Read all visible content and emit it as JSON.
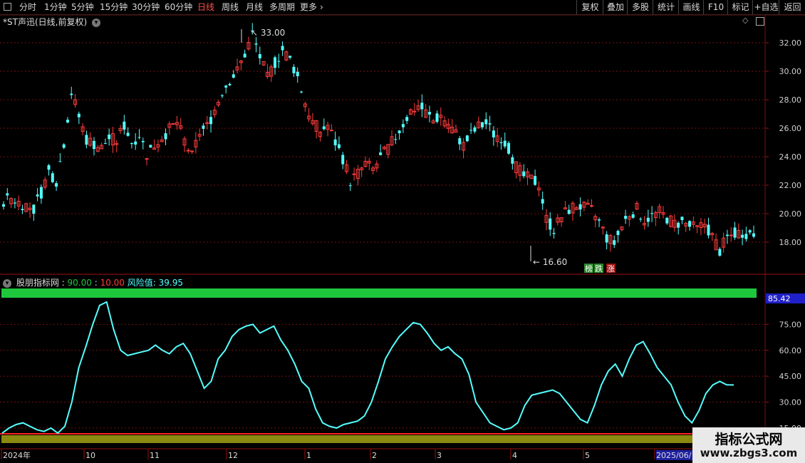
{
  "toolbar": {
    "periods": [
      "分时",
      "1分钟",
      "5分钟",
      "15分钟",
      "30分钟",
      "60分钟",
      "日线",
      "周线",
      "月线",
      "多周期",
      "更多"
    ],
    "active_period": "日线",
    "right_buttons": [
      "复权",
      "叠加",
      "多股",
      "统计",
      "画线",
      "F10",
      "标记",
      "+自选",
      "返回"
    ]
  },
  "colors": {
    "up": "#ff3c3c",
    "down": "#54ffff",
    "grid": "#7a1010",
    "ind_line": "#54ffff",
    "upper_band": "#1ec83c",
    "lower_band": "#8a8a10",
    "red_line": "#ff2020",
    "ind_value_bg": "#2020c8"
  },
  "main_chart": {
    "title": "*ST声迅(日线,前复权)",
    "price_ticks": [
      "32.00",
      "30.00",
      "28.00",
      "26.00",
      "24.00",
      "22.00",
      "20.00",
      "18.00"
    ],
    "high_label": "33.00",
    "low_label": "16.60",
    "badges": [
      "榜",
      "跌",
      "涨"
    ]
  },
  "indicator": {
    "name": "股朋指标网",
    "upper_value": "90.00",
    "lower_value": "10.00",
    "risk_label": "风险值: 39.95",
    "current_value": "85.42",
    "axis_ticks": [
      "75.00",
      "60.00",
      "45.00",
      "30.00",
      "15.00"
    ]
  },
  "x_axis": {
    "labels": [
      "2024年",
      "10",
      "11",
      "12",
      "1",
      "2",
      "3",
      "4",
      "5",
      "2025/06/"
    ]
  },
  "watermark": {
    "line1": "指标公式网",
    "line2": "www.zbgs3.com"
  },
  "chart_data": {
    "type": "candlestick",
    "price_range": [
      16.6,
      33.0
    ],
    "indicator_range": [
      10,
      90
    ],
    "close_trend": [
      20.9,
      21.1,
      20.8,
      20.6,
      20.3,
      21.5,
      23.0,
      22.3,
      25.0,
      28.5,
      26.8,
      25.2,
      24.9,
      24.6,
      25.3,
      25.1,
      26.2,
      25.0,
      25.6,
      24.2,
      24.8,
      25.4,
      25.9,
      26.4,
      25.1,
      24.0,
      25.7,
      26.1,
      27.3,
      28.6,
      29.4,
      30.0,
      31.2,
      32.6,
      31.0,
      29.5,
      30.6,
      31.5,
      30.8,
      29.6,
      27.8,
      26.4,
      25.8,
      26.2,
      25.0,
      23.9,
      22.3,
      22.8,
      23.5,
      23.1,
      23.9,
      24.6,
      25.4,
      26.3,
      27.2,
      27.6,
      27.1,
      26.5,
      26.9,
      26.3,
      25.6,
      24.8,
      25.5,
      26.1,
      26.3,
      25.6,
      25.4,
      24.6,
      23.3,
      22.6,
      22.4,
      22.1,
      19.6,
      18.9,
      19.8,
      20.3,
      20.6,
      20.4,
      20.2,
      19.4,
      18.3,
      17.9,
      19.1,
      20.0,
      20.3,
      19.6,
      19.8,
      20.1,
      19.7,
      19.3,
      19.4,
      19.1,
      18.9,
      19.3,
      18.4,
      17.4,
      18.3,
      18.6,
      18.7,
      18.6,
      18.5
    ],
    "indicator_series": [
      12,
      15,
      17,
      18,
      16,
      14,
      13,
      15,
      12,
      16,
      30,
      50,
      62,
      75,
      86,
      88,
      72,
      60,
      57,
      58,
      59,
      60,
      63,
      60,
      58,
      62,
      64,
      58,
      48,
      38,
      42,
      55,
      60,
      68,
      72,
      74,
      75,
      70,
      72,
      74,
      66,
      60,
      52,
      42,
      38,
      26,
      18,
      16,
      15,
      17,
      18,
      19,
      22,
      30,
      42,
      55,
      62,
      68,
      72,
      76,
      75,
      70,
      64,
      60,
      62,
      58,
      55,
      46,
      30,
      24,
      18,
      16,
      14,
      15,
      18,
      28,
      34,
      35,
      36,
      37,
      35,
      30,
      25,
      20,
      18,
      28,
      40,
      48,
      52,
      45,
      55,
      63,
      65,
      58,
      50,
      45,
      40,
      30,
      22,
      18,
      25,
      35,
      40,
      42,
      40,
      39.95
    ]
  }
}
